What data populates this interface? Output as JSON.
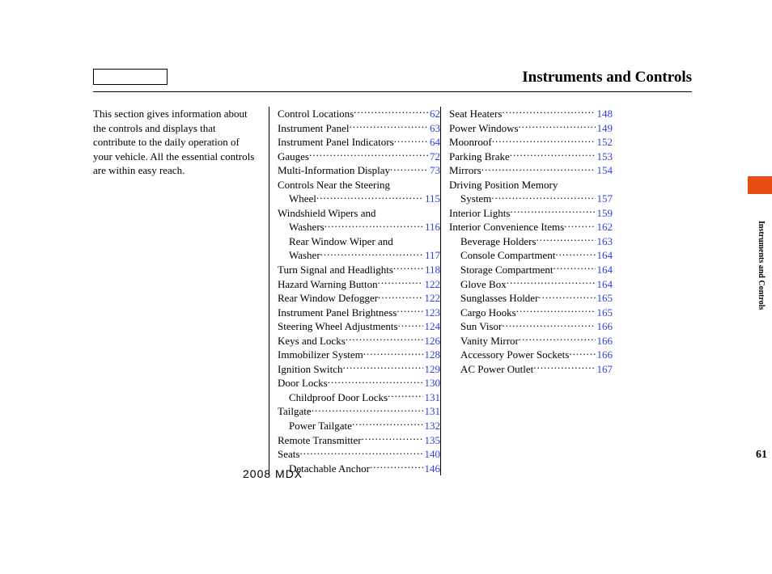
{
  "title": "Instruments and Controls",
  "intro": "This section gives information about the controls and displays that contribute to the daily operation of your vehicle. All the essential controls are within easy reach.",
  "side_label": "Instruments and Controls",
  "page_number": "61",
  "footer": "2008  MDX",
  "toc_col1": [
    {
      "label": "Control Locations",
      "page": "62",
      "indent": 0
    },
    {
      "label": "Instrument Panel",
      "page": "63",
      "indent": 0
    },
    {
      "label": "Instrument Panel Indicators",
      "page": "64",
      "indent": 0
    },
    {
      "label": "Gauges",
      "page": "72",
      "indent": 0
    },
    {
      "label": "Multi-Information Display",
      "page": "73",
      "indent": 0
    },
    {
      "label": "Controls Near the Steering",
      "page": "",
      "indent": 0,
      "nopage": true
    },
    {
      "label": "Wheel",
      "page": "115",
      "indent": 1
    },
    {
      "label": "Windshield Wipers and",
      "page": "",
      "indent": 0,
      "nopage": true
    },
    {
      "label": "Washers",
      "page": "116",
      "indent": 1
    },
    {
      "label": "Rear Window Wiper and",
      "page": "",
      "indent": 1,
      "nopage": true
    },
    {
      "label": "Washer",
      "page": "117",
      "indent": 1
    },
    {
      "label": "Turn Signal and Headlights",
      "page": "118",
      "indent": 0
    },
    {
      "label": "Hazard Warning Button",
      "page": "122",
      "indent": 0
    },
    {
      "label": "Rear Window Defogger",
      "page": "122",
      "indent": 0
    },
    {
      "label": "Instrument Panel Brightness",
      "page": "123",
      "indent": 0
    },
    {
      "label": "Steering Wheel Adjustments",
      "page": "124",
      "indent": 0
    },
    {
      "label": "Keys and Locks",
      "page": "126",
      "indent": 0
    },
    {
      "label": "Immobilizer System",
      "page": "128",
      "indent": 0
    },
    {
      "label": "Ignition Switch",
      "page": "129",
      "indent": 0
    },
    {
      "label": "Door Locks",
      "page": "130",
      "indent": 0
    },
    {
      "label": "Childproof Door Locks",
      "page": "131",
      "indent": 1
    },
    {
      "label": "Tailgate",
      "page": "131",
      "indent": 0
    },
    {
      "label": "Power Tailgate",
      "page": "132",
      "indent": 1
    },
    {
      "label": "Remote Transmitter",
      "page": "135",
      "indent": 0
    },
    {
      "label": "Seats",
      "page": "140",
      "indent": 0
    },
    {
      "label": "Detachable Anchor",
      "page": "146",
      "indent": 1
    }
  ],
  "toc_col2": [
    {
      "label": "Seat Heaters",
      "page": "148",
      "indent": 0
    },
    {
      "label": "Power Windows",
      "page": "149",
      "indent": 0
    },
    {
      "label": "Moonroof",
      "page": "152",
      "indent": 0
    },
    {
      "label": "Parking Brake",
      "page": "153",
      "indent": 0
    },
    {
      "label": "Mirrors",
      "page": "154",
      "indent": 0
    },
    {
      "label": "Driving Position Memory",
      "page": "",
      "indent": 0,
      "nopage": true
    },
    {
      "label": "System",
      "page": "157",
      "indent": 1
    },
    {
      "label": "Interior Lights",
      "page": "159",
      "indent": 0
    },
    {
      "label": "Interior Convenience Items",
      "page": "162",
      "indent": 0
    },
    {
      "label": "Beverage Holders",
      "page": "163",
      "indent": 1
    },
    {
      "label": "Console Compartment",
      "page": "164",
      "indent": 1
    },
    {
      "label": "Storage Compartment",
      "page": "164",
      "indent": 1
    },
    {
      "label": "Glove Box",
      "page": "164",
      "indent": 1
    },
    {
      "label": "Sunglasses Holder",
      "page": "165",
      "indent": 1
    },
    {
      "label": "Cargo Hooks",
      "page": "165",
      "indent": 1
    },
    {
      "label": "Sun Visor",
      "page": "166",
      "indent": 1
    },
    {
      "label": "Vanity Mirror",
      "page": "166",
      "indent": 1
    },
    {
      "label": "Accessory Power Sockets",
      "page": "166",
      "indent": 1
    },
    {
      "label": "AC Power Outlet",
      "page": "167",
      "indent": 1
    }
  ]
}
